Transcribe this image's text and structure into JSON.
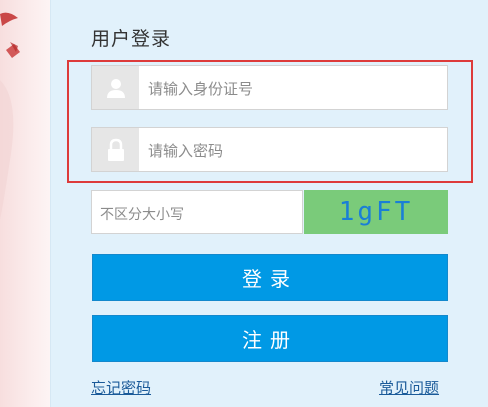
{
  "login": {
    "title": "用户登录",
    "id_placeholder": "请输入身份证号",
    "password_placeholder": "请输入密码",
    "captcha_placeholder": "不区分大小写",
    "captcha_text": "1gFT",
    "login_button": "登录",
    "register_button": "注册",
    "forgot_password_link": "忘记密码",
    "faq_link": "常见问题"
  },
  "icons": {
    "user": "user-icon",
    "lock": "lock-icon"
  },
  "colors": {
    "panel_bg": "#e1f1fb",
    "button_bg": "#0099e5",
    "captcha_bg": "#7acb7a",
    "captcha_text": "#1a7fd6",
    "highlight_border": "#dd3b3b",
    "link": "#1a5a99"
  }
}
